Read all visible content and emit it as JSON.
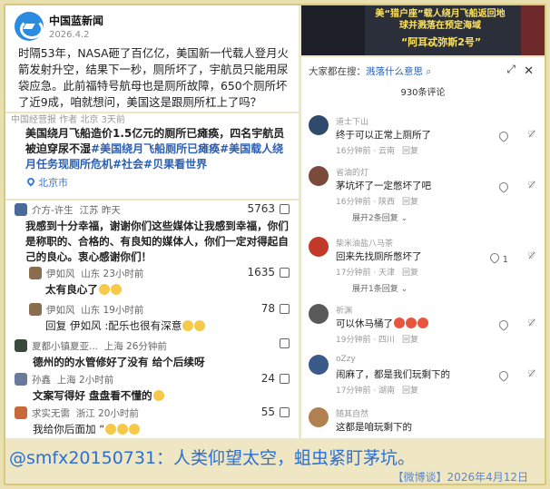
{
  "news": {
    "source": "中国蓝新闻",
    "date": "2026.4.2",
    "body": "时隔53年，NASA砸了百亿亿，美国新一代载人登月火箭发射升空，结果下一秒，厕所坏了，宇航员只能用尿袋应急。此前福特号航母也是厕所故障，650个厕所坏了近9成，咱就想问，美国这是跟厕所杠上了吗？"
  },
  "repost": {
    "header": "中国经营报 作者 北京 3天前",
    "tag": "作者",
    "body_plain": "美国绕月飞船造价1.5亿元的厕所已瘫痪，四名宇航员被迫穿尿不湿",
    "hashtags": "#美国绕月飞船厕所已瘫痪#美国载人绕月任务现厕所危机#社会#贝果看世界",
    "location": "北京市"
  },
  "left_comments": [
    {
      "user": "介方-许生",
      "meta": "江苏  昨天",
      "count": "5763",
      "text": "我感到十分幸福，谢谢你们这些媒体让我感到幸福，你们是称职的、合格的、有良知的媒体人，你们一定对得起自己的良心。衷心感谢你们！",
      "avatar_color": "#4a6a9c"
    },
    {
      "user": "伊如风",
      "meta": "山东  23小时前",
      "count": "1635",
      "text": "太有良心了",
      "avatar_color": "#8a6d4f"
    },
    {
      "user": "伊如风",
      "meta": "山东  19小时前",
      "count": "78",
      "text": "回复 伊如风 :配乐也很有深意",
      "avatar_color": "#8a6d4f"
    },
    {
      "user": "夏都小镇夏亚...",
      "meta": "上海  26分钟前",
      "count": "",
      "text": "德州的的水管修好了没有 给个后续呀",
      "avatar_color": "#3a4a3a"
    },
    {
      "user": "孙鑫",
      "meta": "上海  2小时前",
      "count": "24",
      "text": "文案写得好 盘盘看不懂的",
      "avatar_color": "#6a7a9a"
    },
    {
      "user": "求实无需",
      "meta": "浙江  20小时前",
      "count": "55",
      "text": "我给你后面加 “",
      "avatar_color": "#c76a3a"
    }
  ],
  "video": {
    "caption": "美“猎户座”载人绕月飞船返回地球并溅落在预定海域",
    "caption2": "“阿耳忒弥斯2号”"
  },
  "right_panel": {
    "search_prefix": "大家都在搜：",
    "search_query": "溅落什么意思",
    "comment_count": "930条评论",
    "comments": [
      {
        "name": "道士下山",
        "text": "终于可以正常上厕所了",
        "meta": "16分钟前 · 云南",
        "reply": "回复",
        "likes": "",
        "expand": "",
        "avatar_color": "#2f4a6a"
      },
      {
        "name": "省油的灯",
        "text": "茅坑坏了一定憋坏了吧",
        "meta": "16分钟前 · 陕西",
        "reply": "回复",
        "likes": "",
        "expand": "展开2条回复",
        "avatar_color": "#7a4a3a"
      },
      {
        "name": "柴米油盐八马茶",
        "text": "回来先找厕所憋坏了",
        "meta": "17分钟前 · 天津",
        "reply": "回复",
        "likes": "1",
        "expand": "展开1条回复",
        "avatar_color": "#c23a2a"
      },
      {
        "name": "祈渊",
        "text": "可以休马桶了",
        "meta": "19分钟前 · 四川",
        "reply": "回复",
        "likes": "",
        "expand": "",
        "avatar_color": "#5a5a5a"
      },
      {
        "name": "oZzy",
        "text": "闹麻了，都是我们玩剩下的",
        "meta": "17分钟前 · 湖南",
        "reply": "回复",
        "likes": "",
        "expand": "",
        "avatar_color": "#3a5a8a"
      },
      {
        "name": "随其自然",
        "text": "这都是咱玩剩下的",
        "meta": "",
        "reply": "",
        "likes": "",
        "expand": "",
        "avatar_color": "#b08050"
      }
    ]
  },
  "footer": {
    "main": "@smfx20150731：人类仰望太空，蛆虫紧盯茅坑。",
    "sub": "【微博谈】2026年4月12日"
  }
}
